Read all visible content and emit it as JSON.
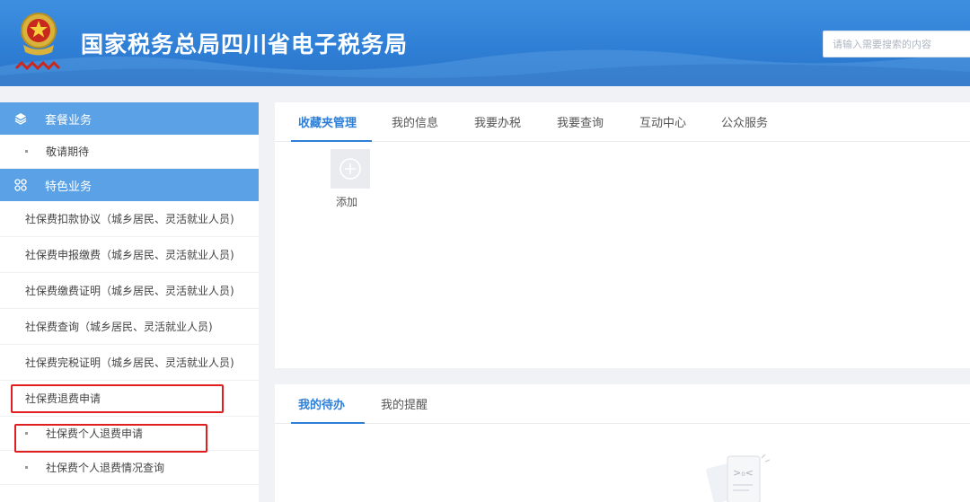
{
  "header": {
    "title": "国家税务总局四川省电子税务局",
    "search_placeholder": "请输入需要搜索的内容",
    "emblem_icon": "national-tax-emblem-icon"
  },
  "sidebar": {
    "group1": {
      "label": "套餐业务",
      "icon": "layers-icon"
    },
    "group1_items": [
      {
        "label": "敬请期待"
      }
    ],
    "group2": {
      "label": "特色业务",
      "icon": "grid-icon"
    },
    "group2_items": [
      {
        "label": "社保费扣款协议（城乡居民、灵活就业人员)"
      },
      {
        "label": "社保费申报缴费（城乡居民、灵活就业人员)"
      },
      {
        "label": "社保费缴费证明（城乡居民、灵活就业人员)"
      },
      {
        "label": "社保费查询（城乡居民、灵活就业人员)"
      },
      {
        "label": "社保费完税证明（城乡居民、灵活就业人员)"
      },
      {
        "label": "社保费退费申请"
      }
    ],
    "refund_sub_items": [
      {
        "label": "社保费个人退费申请"
      },
      {
        "label": "社保费个人退费情况查询"
      }
    ]
  },
  "top_panel": {
    "tabs": [
      {
        "label": "收藏夹管理",
        "active": true
      },
      {
        "label": "我的信息",
        "active": false
      },
      {
        "label": "我要办税",
        "active": false
      },
      {
        "label": "我要查询",
        "active": false
      },
      {
        "label": "互动中心",
        "active": false
      },
      {
        "label": "公众服务",
        "active": false
      }
    ],
    "add_label": "添加",
    "add_icon": "plus-circle-icon"
  },
  "bottom_panel": {
    "tabs": [
      {
        "label": "我的待办",
        "active": true
      },
      {
        "label": "我的提醒",
        "active": false
      }
    ],
    "empty_icon": "empty-document-icon"
  },
  "colors": {
    "header_blue": "#2f7fd6",
    "sidebar_group_blue": "#5aa1e6",
    "active_tab": "#2f7fd6",
    "highlight_red": "#e02020"
  }
}
